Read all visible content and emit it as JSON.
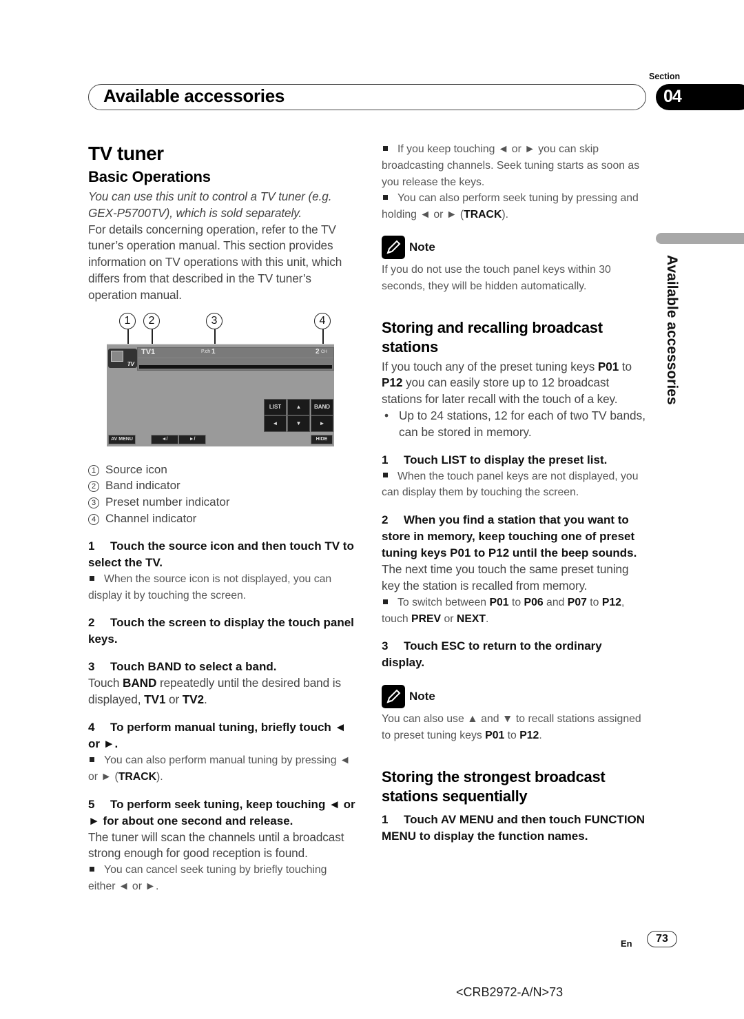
{
  "header": {
    "section_label": "Section",
    "section_number": "04",
    "title": "Available accessories",
    "side_tab_text": "Available accessories"
  },
  "left": {
    "title": "TV tuner",
    "subtitle": "Basic Operations",
    "intro_italic": "You can use this unit to control a TV tuner (e.g. GEX-P5700TV), which is sold separately.",
    "intro_body": "For details concerning operation, refer to the TV tuner’s operation manual. This section provides information on TV operations with this unit, which differs from that described in the TV tuner’s operation manual.",
    "figure": {
      "callouts": [
        "1",
        "2",
        "3",
        "4"
      ],
      "band": "TV1",
      "preset_label": "P.ch",
      "preset_value": "1",
      "channel_value": "2",
      "channel_unit": "CH",
      "source_label": "TV",
      "keys": [
        "LIST",
        "▲",
        "BAND",
        "◄",
        "▼",
        "►"
      ],
      "bottom_keys": [
        "AV MENU",
        "◄/",
        "►/",
        "HIDE"
      ]
    },
    "legend": [
      {
        "num": "1",
        "label": "Source icon"
      },
      {
        "num": "2",
        "label": "Band indicator"
      },
      {
        "num": "3",
        "label": "Preset number indicator"
      },
      {
        "num": "4",
        "label": "Channel indicator"
      }
    ],
    "step1": {
      "num": "1",
      "text": "Touch the source icon and then touch TV to select the TV."
    },
    "step1_bullet": "When the source icon is not displayed, you can display it by touching the screen.",
    "step2": {
      "num": "2",
      "text": "Touch the screen to display the touch panel keys."
    },
    "step3": {
      "num": "3",
      "text": "Touch BAND to select a band."
    },
    "step3_body": {
      "a": "Touch ",
      "b1": "BAND",
      "c": " repeatedly until the desired band is displayed, ",
      "b2": "TV1",
      "d": " or ",
      "b3": "TV2",
      "e": "."
    },
    "step4": {
      "num": "4",
      "text": "To perform manual tuning, briefly touch ◄ or ►."
    },
    "step4_bullet": {
      "a": "You can also perform manual tuning by pressing ◄ or ► (",
      "b": "TRACK",
      "c": ")."
    },
    "step5": {
      "num": "5",
      "text": "To perform seek tuning, keep touching ◄ or ► for about one second and release."
    },
    "step5_body": "The tuner will scan the channels until a broadcast strong enough for good reception is found.",
    "step5_bullet": "You can cancel seek tuning by briefly touching either ◄ or ►."
  },
  "right": {
    "bullet1": "If you keep touching ◄ or ► you can skip broadcasting channels. Seek tuning starts as soon as you release the keys.",
    "bullet2": {
      "a": "You can also perform seek tuning by pressing and holding ◄ or ► (",
      "b": "TRACK",
      "c": ")."
    },
    "note1_label": "Note",
    "note1_text": "If you do not use the touch panel keys within 30 seconds, they will be hidden automatically.",
    "section2_title": "Storing and recalling broadcast stations",
    "section2_body": {
      "a": "If you touch any of the preset tuning keys ",
      "b1": "P01",
      "c": " to ",
      "b2": "P12",
      "d": " you can easily store up to 12 broadcast stations for later recall with the touch of a key."
    },
    "section2_dot": "Up to 24 stations, 12 for each of two TV bands, can be stored in memory.",
    "s2_step1": {
      "num": "1",
      "text": "Touch LIST to display the preset list."
    },
    "s2_step1_bullet": "When the touch panel keys are not displayed, you can display them by touching the screen.",
    "s2_step2": {
      "num": "2",
      "text": "When you find a station that you want to store in memory, keep touching one of preset tuning keys P01 to P12 until the beep sounds."
    },
    "s2_step2_body": "The next time you touch the same preset tuning key the station is recalled from memory.",
    "s2_step2_bullet": {
      "a": "To switch between ",
      "b1": "P01",
      "c": " to ",
      "b2": "P06",
      "d": " and ",
      "b3": "P07",
      "e": " to ",
      "b4": "P12",
      "f": ", touch ",
      "b5": "PREV",
      "g": " or ",
      "b6": "NEXT",
      "h": "."
    },
    "s2_step3": {
      "num": "3",
      "text": "Touch ESC to return to the ordinary display."
    },
    "note2_label": "Note",
    "note2_text": {
      "a": "You can also use ▲ and ▼ to recall stations assigned to preset tuning keys ",
      "b1": "P01",
      "c": " to ",
      "b2": "P12",
      "d": "."
    },
    "section3_title": "Storing the strongest broadcast stations sequentially",
    "s3_step1": {
      "num": "1",
      "text": "Touch AV MENU and then touch FUNCTION MENU to display the function names."
    }
  },
  "footer": {
    "lang": "En",
    "page": "73",
    "doc_code": "<CRB2972-A/N>73"
  }
}
